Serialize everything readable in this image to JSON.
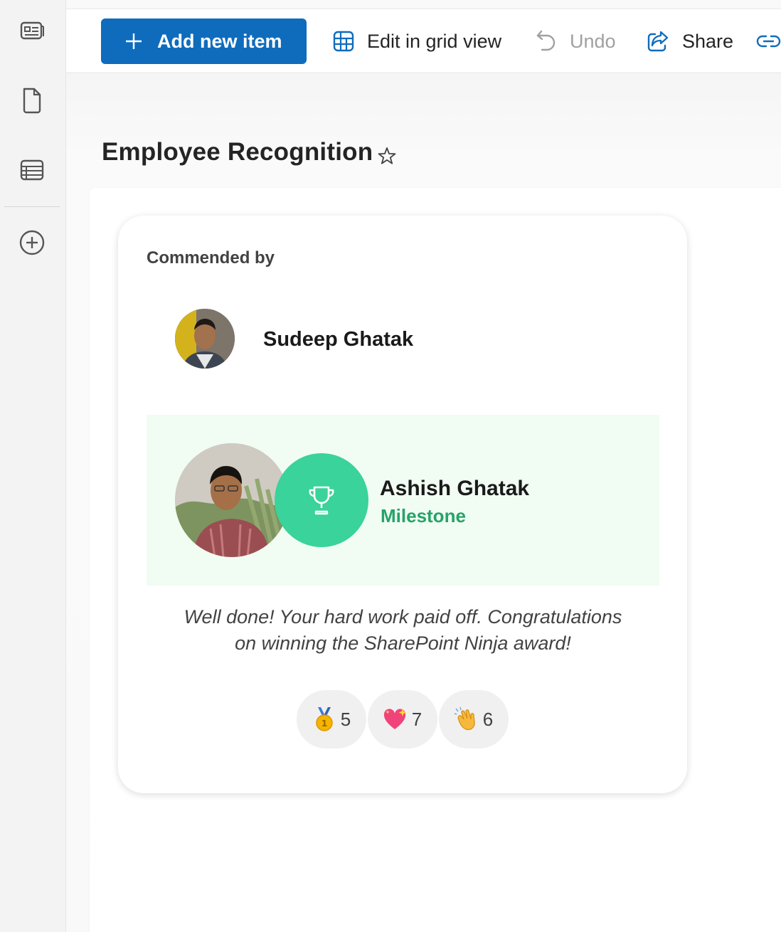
{
  "commandbar": {
    "add_label": "Add new item",
    "grid_label": "Edit in grid view",
    "undo_label": "Undo",
    "share_label": "Share"
  },
  "page": {
    "title": "Employee Recognition"
  },
  "card": {
    "commended_by_label": "Commended by",
    "commender_name": "Sudeep Ghatak",
    "recipient_name": "Ashish Ghatak",
    "award_type": "Milestone",
    "message_line1": "Well done! Your hard work paid off. Congratulations",
    "message_line2": "on winning the SharePoint Ninja award!",
    "reactions": [
      {
        "icon": "medal-icon",
        "count": "5"
      },
      {
        "icon": "sparkling-heart-icon",
        "count": "7"
      },
      {
        "icon": "clapping-hands-icon",
        "count": "6"
      }
    ]
  },
  "colors": {
    "primary": "#0f6cbd",
    "accent_green": "#39d39b",
    "award_text": "#27a36a",
    "award_bg": "#f1fcf3"
  }
}
